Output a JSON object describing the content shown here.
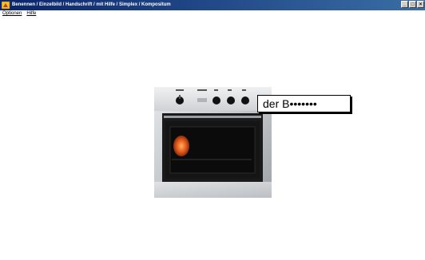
{
  "window": {
    "title": "Benennen / Einzelbild / Handschrift / mit Hilfe / Simplex / Kompositum",
    "controls": {
      "minimize": "_",
      "maximize": "□",
      "close": "×"
    }
  },
  "menu": {
    "items": [
      {
        "label": "Optionen"
      },
      {
        "label": "Hilfe"
      }
    ]
  },
  "main": {
    "image": {
      "subject": "oven"
    },
    "answer": {
      "value": "der B•••••••"
    }
  },
  "colors": {
    "titlebar_start": "#0a246a",
    "titlebar_end": "#3a6ea5",
    "oven_steel": "#c8ccd0",
    "oven_glass": "#151515",
    "oven_interior": "#e4581a"
  }
}
